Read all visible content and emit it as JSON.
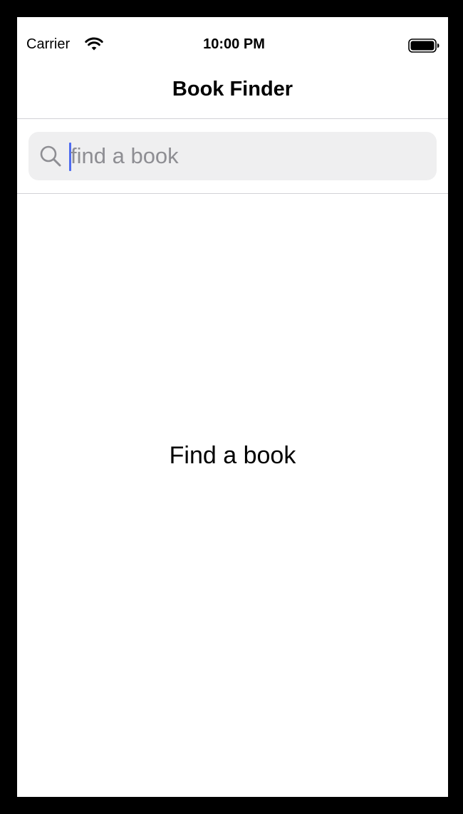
{
  "status_bar": {
    "carrier": "Carrier",
    "time": "10:00 PM",
    "wifi_icon": "wifi-icon",
    "battery_icon": "battery-icon"
  },
  "nav": {
    "title": "Book Finder"
  },
  "search": {
    "icon": "search-icon",
    "placeholder": "find a book",
    "value": ""
  },
  "main": {
    "empty_message": "Find a book"
  },
  "colors": {
    "cursor": "#4f6cf0",
    "search_field_bg": "#efeff0",
    "placeholder": "#8e8e93"
  }
}
